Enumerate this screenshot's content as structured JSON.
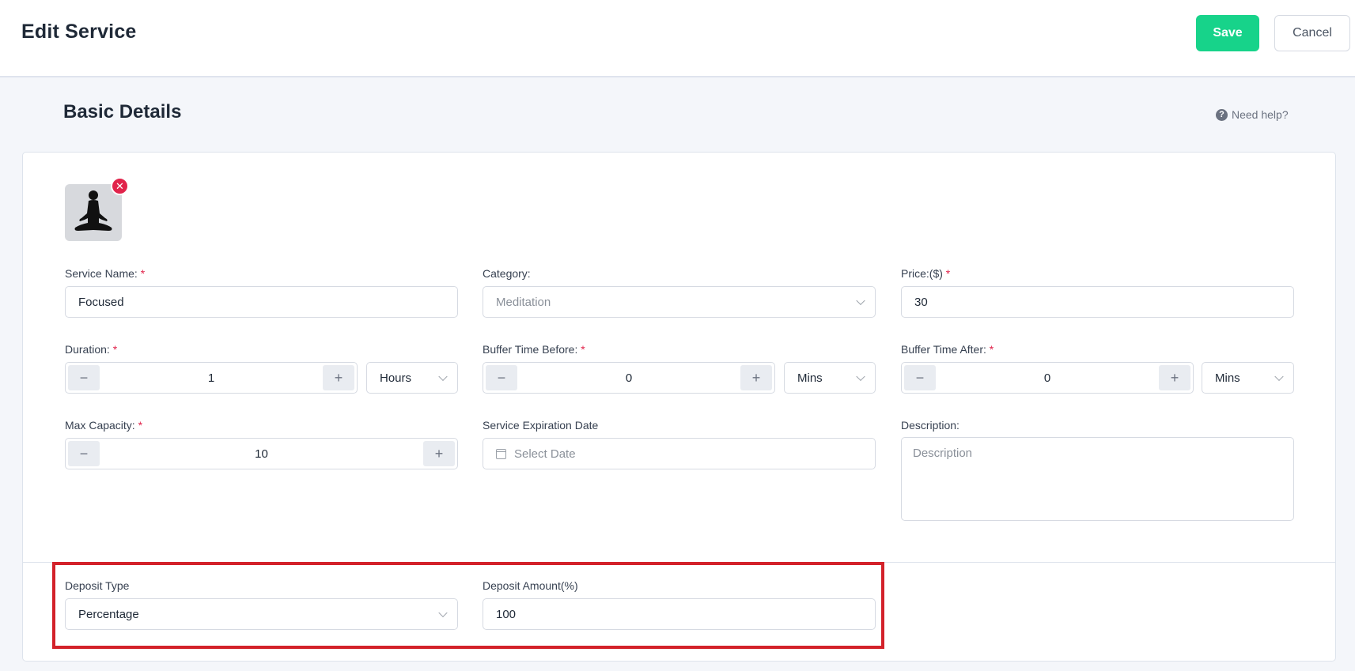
{
  "header": {
    "title": "Edit Service",
    "save_label": "Save",
    "cancel_label": "Cancel"
  },
  "section": {
    "title": "Basic Details",
    "help_label": "Need help?"
  },
  "image": {
    "alt_icon": "meditation-silhouette-icon",
    "remove_icon": "close-icon"
  },
  "fields": {
    "service_name": {
      "label": "Service Name:",
      "required": "*",
      "value": "Focused"
    },
    "category": {
      "label": "Category:",
      "value": "Meditation"
    },
    "price": {
      "label": "Price:($)",
      "required": "*",
      "value": "30"
    },
    "duration": {
      "label": "Duration:",
      "required": "*",
      "value": "1",
      "unit": "Hours"
    },
    "buffer_before": {
      "label": "Buffer Time Before:",
      "required": "*",
      "value": "0",
      "unit": "Mins"
    },
    "buffer_after": {
      "label": "Buffer Time After:",
      "required": "*",
      "value": "0",
      "unit": "Mins"
    },
    "max_capacity": {
      "label": "Max Capacity:",
      "required": "*",
      "value": "10"
    },
    "expiration": {
      "label": "Service Expiration Date",
      "placeholder": "Select Date"
    },
    "description": {
      "label": "Description:",
      "placeholder": "Description"
    },
    "deposit_type": {
      "label": "Deposit Type",
      "value": "Percentage"
    },
    "deposit_amount": {
      "label": "Deposit Amount(%)",
      "value": "100"
    }
  },
  "stepper": {
    "minus": "−",
    "plus": "+"
  },
  "colors": {
    "accent": "#17d38a",
    "danger": "#e1244b",
    "highlight": "#d3222a"
  }
}
